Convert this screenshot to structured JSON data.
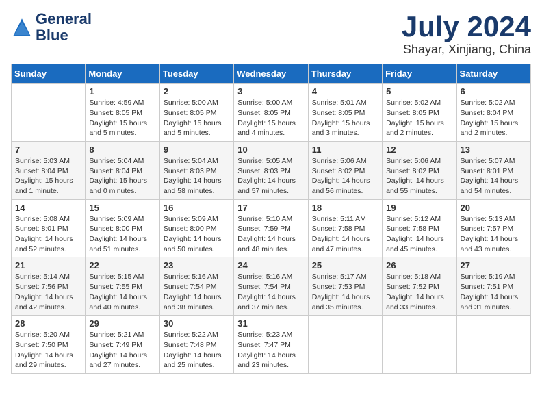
{
  "logo": {
    "name": "GeneralBlue",
    "line1": "General",
    "line2": "Blue"
  },
  "title": "July 2024",
  "subtitle": "Shayar, Xinjiang, China",
  "colors": {
    "header_bg": "#1a6bbf",
    "header_text": "#ffffff",
    "logo_color": "#1a3a6b"
  },
  "weekdays": [
    "Sunday",
    "Monday",
    "Tuesday",
    "Wednesday",
    "Thursday",
    "Friday",
    "Saturday"
  ],
  "weeks": [
    [
      {
        "day": "",
        "content": ""
      },
      {
        "day": "1",
        "content": "Sunrise: 4:59 AM\nSunset: 8:05 PM\nDaylight: 15 hours\nand 5 minutes."
      },
      {
        "day": "2",
        "content": "Sunrise: 5:00 AM\nSunset: 8:05 PM\nDaylight: 15 hours\nand 5 minutes."
      },
      {
        "day": "3",
        "content": "Sunrise: 5:00 AM\nSunset: 8:05 PM\nDaylight: 15 hours\nand 4 minutes."
      },
      {
        "day": "4",
        "content": "Sunrise: 5:01 AM\nSunset: 8:05 PM\nDaylight: 15 hours\nand 3 minutes."
      },
      {
        "day": "5",
        "content": "Sunrise: 5:02 AM\nSunset: 8:05 PM\nDaylight: 15 hours\nand 2 minutes."
      },
      {
        "day": "6",
        "content": "Sunrise: 5:02 AM\nSunset: 8:04 PM\nDaylight: 15 hours\nand 2 minutes."
      }
    ],
    [
      {
        "day": "7",
        "content": "Sunrise: 5:03 AM\nSunset: 8:04 PM\nDaylight: 15 hours\nand 1 minute."
      },
      {
        "day": "8",
        "content": "Sunrise: 5:04 AM\nSunset: 8:04 PM\nDaylight: 15 hours\nand 0 minutes."
      },
      {
        "day": "9",
        "content": "Sunrise: 5:04 AM\nSunset: 8:03 PM\nDaylight: 14 hours\nand 58 minutes."
      },
      {
        "day": "10",
        "content": "Sunrise: 5:05 AM\nSunset: 8:03 PM\nDaylight: 14 hours\nand 57 minutes."
      },
      {
        "day": "11",
        "content": "Sunrise: 5:06 AM\nSunset: 8:02 PM\nDaylight: 14 hours\nand 56 minutes."
      },
      {
        "day": "12",
        "content": "Sunrise: 5:06 AM\nSunset: 8:02 PM\nDaylight: 14 hours\nand 55 minutes."
      },
      {
        "day": "13",
        "content": "Sunrise: 5:07 AM\nSunset: 8:01 PM\nDaylight: 14 hours\nand 54 minutes."
      }
    ],
    [
      {
        "day": "14",
        "content": "Sunrise: 5:08 AM\nSunset: 8:01 PM\nDaylight: 14 hours\nand 52 minutes."
      },
      {
        "day": "15",
        "content": "Sunrise: 5:09 AM\nSunset: 8:00 PM\nDaylight: 14 hours\nand 51 minutes."
      },
      {
        "day": "16",
        "content": "Sunrise: 5:09 AM\nSunset: 8:00 PM\nDaylight: 14 hours\nand 50 minutes."
      },
      {
        "day": "17",
        "content": "Sunrise: 5:10 AM\nSunset: 7:59 PM\nDaylight: 14 hours\nand 48 minutes."
      },
      {
        "day": "18",
        "content": "Sunrise: 5:11 AM\nSunset: 7:58 PM\nDaylight: 14 hours\nand 47 minutes."
      },
      {
        "day": "19",
        "content": "Sunrise: 5:12 AM\nSunset: 7:58 PM\nDaylight: 14 hours\nand 45 minutes."
      },
      {
        "day": "20",
        "content": "Sunrise: 5:13 AM\nSunset: 7:57 PM\nDaylight: 14 hours\nand 43 minutes."
      }
    ],
    [
      {
        "day": "21",
        "content": "Sunrise: 5:14 AM\nSunset: 7:56 PM\nDaylight: 14 hours\nand 42 minutes."
      },
      {
        "day": "22",
        "content": "Sunrise: 5:15 AM\nSunset: 7:55 PM\nDaylight: 14 hours\nand 40 minutes."
      },
      {
        "day": "23",
        "content": "Sunrise: 5:16 AM\nSunset: 7:54 PM\nDaylight: 14 hours\nand 38 minutes."
      },
      {
        "day": "24",
        "content": "Sunrise: 5:16 AM\nSunset: 7:54 PM\nDaylight: 14 hours\nand 37 minutes."
      },
      {
        "day": "25",
        "content": "Sunrise: 5:17 AM\nSunset: 7:53 PM\nDaylight: 14 hours\nand 35 minutes."
      },
      {
        "day": "26",
        "content": "Sunrise: 5:18 AM\nSunset: 7:52 PM\nDaylight: 14 hours\nand 33 minutes."
      },
      {
        "day": "27",
        "content": "Sunrise: 5:19 AM\nSunset: 7:51 PM\nDaylight: 14 hours\nand 31 minutes."
      }
    ],
    [
      {
        "day": "28",
        "content": "Sunrise: 5:20 AM\nSunset: 7:50 PM\nDaylight: 14 hours\nand 29 minutes."
      },
      {
        "day": "29",
        "content": "Sunrise: 5:21 AM\nSunset: 7:49 PM\nDaylight: 14 hours\nand 27 minutes."
      },
      {
        "day": "30",
        "content": "Sunrise: 5:22 AM\nSunset: 7:48 PM\nDaylight: 14 hours\nand 25 minutes."
      },
      {
        "day": "31",
        "content": "Sunrise: 5:23 AM\nSunset: 7:47 PM\nDaylight: 14 hours\nand 23 minutes."
      },
      {
        "day": "",
        "content": ""
      },
      {
        "day": "",
        "content": ""
      },
      {
        "day": "",
        "content": ""
      }
    ]
  ]
}
